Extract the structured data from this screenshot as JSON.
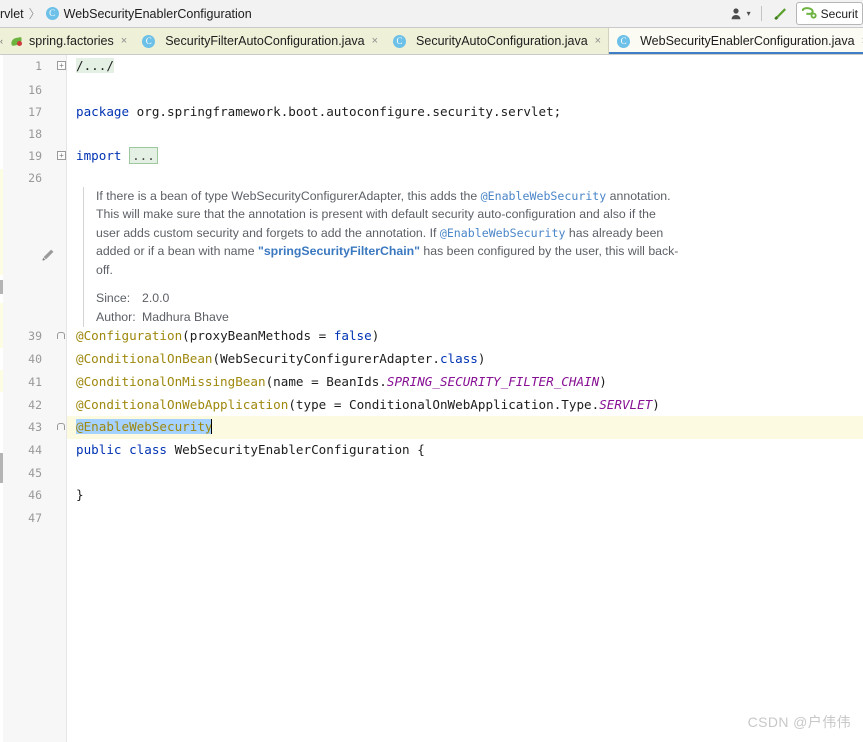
{
  "window": {
    "breadcrumb_prefix": "rvlet",
    "breadcrumb_separator": "〉",
    "breadcrumb_class_badge": "C",
    "breadcrumb_class": "WebSecurityEnablerConfiguration"
  },
  "toolbar": {
    "user_icon": "user-avatar-icon",
    "dropdown_caret": "▾",
    "build_icon": "build-hammer-icon",
    "run_config_icon": "spring-boot-icon",
    "run_config_label": "Securit"
  },
  "tabs": {
    "scroll_left_label": "‹",
    "items": [
      {
        "label": "spring.factories",
        "icon": "spring-leaf-icon",
        "close": "×",
        "active": false
      },
      {
        "label": "SecurityFilterAutoConfiguration.java",
        "icon": "java-class-icon",
        "close": "×",
        "active": false
      },
      {
        "label": "SecurityAutoConfiguration.java",
        "icon": "java-class-icon",
        "close": "×",
        "active": false
      },
      {
        "label": "WebSecurityEnablerConfiguration.java",
        "icon": "java-class-icon",
        "close": "×",
        "active": true
      }
    ],
    "class_badge": "C"
  },
  "editor": {
    "gutter": {
      "line_numbers": [
        "1",
        "16",
        "17",
        "18",
        "19",
        "26",
        "39",
        "40",
        "41",
        "42",
        "43",
        "44",
        "45",
        "46",
        "47"
      ],
      "edit_icon": "pencil-edit-icon"
    },
    "fold_expand": "+",
    "lines": {
      "l1_folded_comment": "/.../",
      "l17_package_kw": "package",
      "l17_package_name": " org.springframework.boot.autoconfigure.security.servlet;",
      "l19_import_kw": "import",
      "l19_import_fold": "...",
      "l39_annotation": "@Configuration",
      "l39_open": "(",
      "l39_param": "proxyBeanMethods = ",
      "l39_value": "false",
      "l39_close": ")",
      "l40_annotation": "@ConditionalOnBean",
      "l40_open": "(",
      "l40_arg": "WebSecurityConfigurerAdapter.",
      "l40_kw": "class",
      "l40_close": ")",
      "l41_annotation": "@ConditionalOnMissingBean",
      "l41_open": "(",
      "l41_param": "name = BeanIds.",
      "l41_const": "SPRING_SECURITY_FILTER_CHAIN",
      "l41_close": ")",
      "l42_annotation": "@ConditionalOnWebApplication",
      "l42_open": "(",
      "l42_param": "type = ConditionalOnWebApplication.Type.",
      "l42_const": "SERVLET",
      "l42_close": ")",
      "l43_annotation": "@EnableWebSecurity",
      "l44_kw_public": "public",
      "l44_kw_class": "class",
      "l44_name": " WebSecurityEnablerConfiguration ",
      "l44_brace": "{",
      "l46_brace": "}"
    }
  },
  "javadoc": {
    "para_1_a": "If there is a bean of type WebSecurityConfigurerAdapter, this adds the ",
    "para_1_code_1": "@EnableWebSecurity",
    "para_1_b": " annotation. This will make sure that the annotation is present with default security auto-configuration and also if the user adds custom security and forgets to add the annotation. If ",
    "para_1_code_2": "@EnableWebSecurity",
    "para_1_c": " has already been added or if a bean with name ",
    "para_1_str": "\"springSecurityFilterChain\"",
    "para_1_d": " has been configured by the user, this will back-off.",
    "since_label": "Since:",
    "since_value": "2.0.0",
    "author_label": "Author:",
    "author_value": "Madhura Bhave"
  },
  "watermark": {
    "text": "CSDN @户伟伟"
  },
  "colors": {
    "tab_strip": "#eff0d8",
    "active_tab": "#fbfbf3",
    "active_tab_underline": "#3d7ec4",
    "selection": "#a6d2ff",
    "current_line": "#fdfae2",
    "annotation": "#9e880d",
    "keyword": "#0033b3",
    "constant_italic": "#871094",
    "string": "#2a9fa0",
    "spring_green": "#6db33f"
  }
}
